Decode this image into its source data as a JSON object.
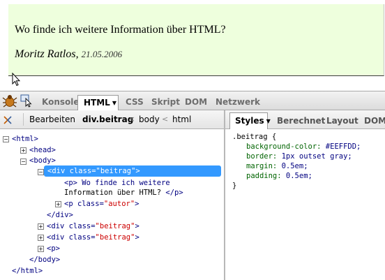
{
  "page": {
    "question": "Wo finde ich weitere Information über HTML?",
    "author": "Moritz Ratlos,",
    "date": "21.05.2006",
    "background_color": "#EEFFDD"
  },
  "toolbar": {
    "tabs": [
      "Konsole",
      "HTML",
      "CSS",
      "Skript",
      "DOM",
      "Netzwerk"
    ],
    "active_tab": "HTML"
  },
  "breadcrumb": {
    "edit_label": "Bearbeiten",
    "items": [
      "div.beitrag",
      "body",
      "html"
    ],
    "separator": "<"
  },
  "side_panel": {
    "tabs": [
      "Styles",
      "Berechnet",
      "Layout",
      "DOM"
    ],
    "active_tab": "Styles"
  },
  "tree": {
    "html_open": "<html>",
    "head": "<head>",
    "body_open": "<body>",
    "div_selected": "<div class=\"beitrag\">",
    "p_line1": "<p> Wo finde ich weitere",
    "p_line2_text": "Information über HTML? ",
    "p_line2_close": "</p>",
    "p_autor_open": "<p class=",
    "p_autor_val": "\"autor\"",
    "tag_end": ">",
    "div_close": "</div>",
    "div_open": "<div class=",
    "div_val": "\"beitrag\"",
    "p_empty": "<p>",
    "body_close": "</body>",
    "html_close": "</html>"
  },
  "css_rule": {
    "selector": ".beitrag {",
    "properties": [
      {
        "name": "background-color:",
        "value": "#EEFFDD;"
      },
      {
        "name": "border:",
        "value": "1px outset gray;"
      },
      {
        "name": "margin:",
        "value": "0.5em;"
      },
      {
        "name": "padding:",
        "value": "0.5em;"
      }
    ],
    "close": "}"
  }
}
